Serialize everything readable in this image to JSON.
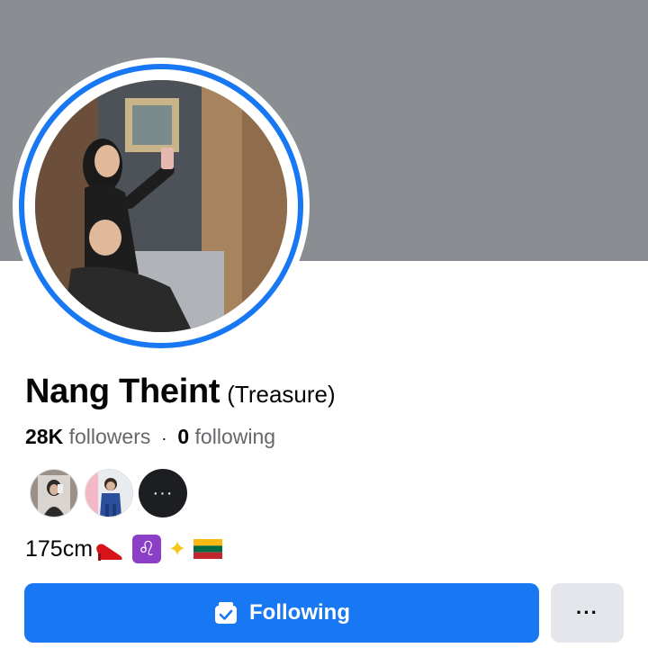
{
  "profile": {
    "name": "Nang Theint",
    "alternate_name": "(Treasure)",
    "followers_count": "28K",
    "followers_label": "followers",
    "following_count": "0",
    "following_label": "following",
    "separator": "·",
    "bio_text": "175cm",
    "bio_emojis": [
      "high-heel-icon",
      "leo-icon",
      "sparkles-icon",
      "lithuania-flag-icon"
    ]
  },
  "mutual_friends": {
    "more_label": "···"
  },
  "actions": {
    "following_label": "Following",
    "more_label": "···"
  },
  "colors": {
    "cover": "#8a8d91",
    "accent": "#1877f2",
    "secondary_button": "#e4e6eb"
  }
}
